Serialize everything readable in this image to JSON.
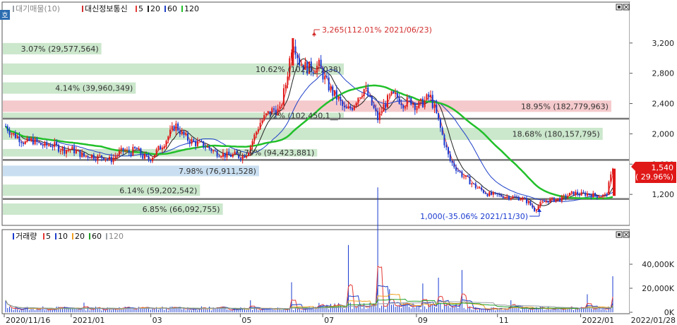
{
  "price_panel": {
    "legend_toggle": "호",
    "legend": [
      {
        "label": "대기매물(10)",
        "color": "#9aa0a6"
      },
      {
        "label": "대신정보통신",
        "color": "#d32f2f"
      },
      {
        "label": "5",
        "color": "#e53935"
      },
      {
        "label": "20",
        "color": "#222222"
      },
      {
        "label": "60",
        "color": "#1e40c8"
      },
      {
        "label": "120",
        "color": "#22c02a"
      }
    ],
    "high_annotation": "3,265(112.01% 2021/06/23)",
    "low_annotation": "1,000(-35.06% 2021/11/30)",
    "current_price_label": "1,540",
    "current_change_label": "( 29.96%)",
    "colors": {
      "up": "#e01818",
      "down": "#1a3ad0",
      "current_badge": "#e01818"
    }
  },
  "volume_panel": {
    "legend": [
      {
        "label": "거래량",
        "color": "#1a3ad0"
      },
      {
        "label": "5",
        "color": "#e53935"
      },
      {
        "label": "10",
        "color": "#1e40c8"
      },
      {
        "label": "20",
        "color": "#f0a020"
      },
      {
        "label": "60",
        "color": "#22a02a"
      },
      {
        "label": "120",
        "color": "#9aa0a6"
      }
    ]
  },
  "x_axis": {
    "ticks": [
      "2020/11/16",
      "2021/01",
      "03",
      "05",
      "07",
      "09",
      "11",
      "2022/01"
    ],
    "end_label": "2022/01/28"
  },
  "chart_data": [
    {
      "type": "bar",
      "name": "price-chart-supply-zones",
      "y_ticks": [
        "3,200",
        "2,800",
        "2,400",
        "2,000",
        "1,600",
        "1,200"
      ],
      "ylim": [
        800,
        3600
      ],
      "supply_zones": [
        {
          "label": "3.07% (29,577,564)",
          "low": 3050,
          "high": 3200,
          "pct": 3.07
        },
        {
          "label": "10.62% (102,0__,038)",
          "low": 2780,
          "high": 2930,
          "pct": 10.62
        },
        {
          "label": "4.14% (39,960,349)",
          "low": 2530,
          "high": 2680,
          "pct": 4.14
        },
        {
          "label": "18.95% (182,779,963)",
          "low": 2290,
          "high": 2440,
          "pct": 18.95,
          "highlight": true
        },
        {
          "label": "72% (102,450,1__)",
          "low": 2200,
          "high": 2280,
          "pct": 10.62
        },
        {
          "label": "18.68% (180,157,795)",
          "low": 1920,
          "high": 2080,
          "pct": 18.68
        },
        {
          "label": "9.79% (94,423,881)",
          "low": 1700,
          "high": 1800,
          "pct": 9.79
        },
        {
          "label": "7.98% (76,911,528)",
          "low": 1440,
          "high": 1580,
          "pct": 7.98,
          "current": true
        },
        {
          "label": "6.14% (59,202,542)",
          "low": 1180,
          "high": 1330,
          "pct": 6.14
        },
        {
          "label": "6.85% (66,092,755)",
          "low": 930,
          "high": 1080,
          "pct": 6.85
        }
      ],
      "horizontal_lines": [
        2200,
        1655,
        1140
      ],
      "price_path": [
        [
          0,
          2100
        ],
        [
          8,
          2000
        ],
        [
          16,
          1950
        ],
        [
          24,
          1880
        ],
        [
          32,
          1920
        ],
        [
          40,
          1870
        ],
        [
          48,
          1840
        ],
        [
          56,
          1860
        ],
        [
          64,
          1820
        ],
        [
          72,
          1790
        ],
        [
          80,
          1800
        ],
        [
          88,
          1760
        ],
        [
          96,
          1700
        ],
        [
          104,
          1720
        ],
        [
          112,
          1690
        ],
        [
          120,
          1700
        ],
        [
          128,
          1650
        ],
        [
          136,
          1720
        ],
        [
          144,
          1780
        ],
        [
          152,
          1750
        ],
        [
          160,
          1800
        ],
        [
          168,
          1700
        ],
        [
          176,
          1660
        ],
        [
          184,
          1760
        ],
        [
          192,
          1850
        ],
        [
          200,
          1980
        ],
        [
          208,
          2120
        ],
        [
          216,
          2000
        ],
        [
          224,
          1920
        ],
        [
          232,
          1880
        ],
        [
          240,
          1860
        ],
        [
          248,
          1820
        ],
        [
          256,
          1760
        ],
        [
          264,
          1740
        ],
        [
          272,
          1710
        ],
        [
          280,
          1720
        ],
        [
          288,
          1700
        ],
        [
          296,
          1750
        ],
        [
          304,
          1950
        ],
        [
          312,
          2150
        ],
        [
          320,
          2250
        ],
        [
          328,
          2320
        ],
        [
          336,
          2300
        ],
        [
          344,
          2700
        ],
        [
          352,
          3265
        ],
        [
          360,
          2950
        ],
        [
          368,
          2880
        ],
        [
          376,
          2860
        ],
        [
          384,
          2900
        ],
        [
          392,
          2700
        ],
        [
          400,
          2550
        ],
        [
          408,
          2450
        ],
        [
          416,
          2300
        ],
        [
          424,
          2350
        ],
        [
          432,
          2500
        ],
        [
          440,
          2600
        ],
        [
          448,
          2400
        ],
        [
          456,
          2200
        ],
        [
          464,
          2380
        ],
        [
          472,
          2500
        ],
        [
          480,
          2480
        ],
        [
          488,
          2400
        ],
        [
          496,
          2450
        ],
        [
          504,
          2360
        ],
        [
          512,
          2420
        ],
        [
          520,
          2500
        ],
        [
          528,
          2250
        ],
        [
          536,
          1950
        ],
        [
          544,
          1650
        ],
        [
          552,
          1550
        ],
        [
          560,
          1450
        ],
        [
          568,
          1380
        ],
        [
          576,
          1300
        ],
        [
          584,
          1250
        ],
        [
          592,
          1200
        ],
        [
          600,
          1190
        ],
        [
          608,
          1180
        ],
        [
          616,
          1170
        ],
        [
          624,
          1160
        ],
        [
          632,
          1150
        ],
        [
          640,
          1100
        ],
        [
          648,
          1000
        ],
        [
          656,
          1080
        ],
        [
          664,
          1120
        ],
        [
          672,
          1130
        ],
        [
          680,
          1140
        ],
        [
          688,
          1180
        ],
        [
          696,
          1220
        ],
        [
          704,
          1200
        ],
        [
          712,
          1210
        ],
        [
          720,
          1190
        ],
        [
          728,
          1180
        ],
        [
          736,
          1185
        ],
        [
          744,
          1540
        ]
      ],
      "bar_colors": {
        "up": "#e01818",
        "down": "#1a3ad0"
      }
    },
    {
      "type": "bar",
      "name": "volume-chart",
      "y_ticks": [
        "40,000K",
        "20,000K",
        "0K"
      ],
      "ylim": [
        0,
        60000
      ],
      "volume_spikes": [
        {
          "t": 0,
          "v": 10000
        },
        {
          "t": 95,
          "v": 8000
        },
        {
          "t": 300,
          "v": 10000
        },
        {
          "t": 350,
          "v": 25000
        },
        {
          "t": 420,
          "v": 35000
        },
        {
          "t": 455,
          "v": 65000
        },
        {
          "t": 470,
          "v": 12000
        },
        {
          "t": 512,
          "v": 15000
        },
        {
          "t": 530,
          "v": 18000
        },
        {
          "t": 560,
          "v": 22000
        },
        {
          "t": 620,
          "v": 10000
        },
        {
          "t": 712,
          "v": 15000
        },
        {
          "t": 744,
          "v": 30000
        }
      ]
    }
  ]
}
